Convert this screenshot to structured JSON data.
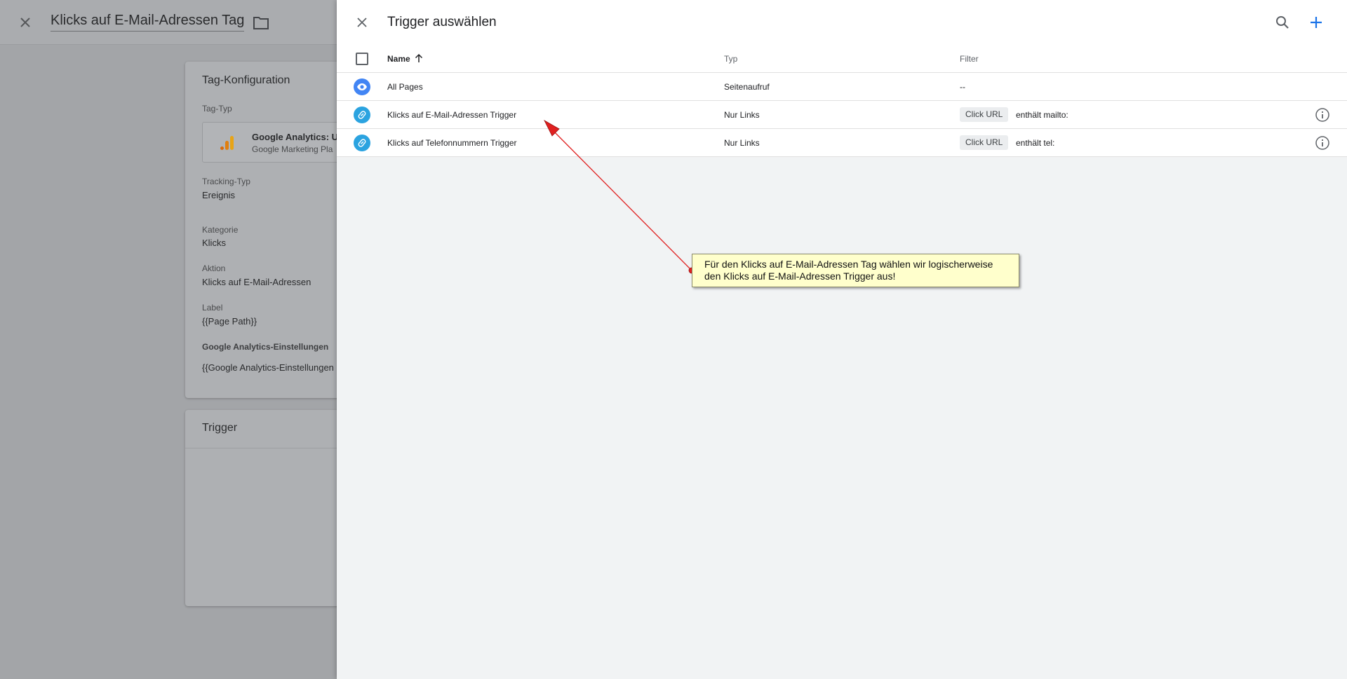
{
  "background_editor": {
    "title": "Klicks auf E-Mail-Adressen Tag",
    "config_card": {
      "title": "Tag-Konfiguration",
      "tag_type_label": "Tag-Typ",
      "tag_type_name": "Google Analytics: Ur",
      "tag_type_sub": "Google Marketing Pla",
      "tracking_type_label": "Tracking-Typ",
      "tracking_type_value": "Ereignis",
      "category_label": "Kategorie",
      "category_value": "Klicks",
      "action_label": "Aktion",
      "action_value": "Klicks auf E-Mail-Adressen",
      "label_label": "Label",
      "label_value": "{{Page Path}}",
      "ga_settings_label": "Google Analytics-Einstellungen",
      "ga_settings_value": "{{Google Analytics-Einstellungen"
    },
    "trigger_card": {
      "title": "Trigger"
    }
  },
  "panel": {
    "title": "Trigger auswählen",
    "columns": {
      "name": "Name",
      "type": "Typ",
      "filter": "Filter"
    },
    "rows": [
      {
        "name": "All Pages",
        "type": "Seitenaufruf",
        "filter_text": "--",
        "icon": "eye-icon"
      },
      {
        "name": "Klicks auf E-Mail-Adressen Trigger",
        "type": "Nur Links",
        "filter_var": "Click URL",
        "filter_op": "enthält mailto:",
        "icon": "link-icon"
      },
      {
        "name": "Klicks auf Telefonnummern Trigger",
        "type": "Nur Links",
        "filter_var": "Click URL",
        "filter_op": "enthält tel:",
        "icon": "link-icon"
      }
    ]
  },
  "annotation": {
    "line1": "Für den Klicks auf E-Mail-Adressen Tag wählen wir logischerweise",
    "line2": "den Klicks auf E-Mail-Adressen Trigger aus!"
  },
  "colors": {
    "accent_blue": "#1a73e8",
    "trigger_icon_blue": "#4285f4",
    "trigger_icon_cyan": "#2ba3e0",
    "annotation_bg": "#ffffcc",
    "arrow_red": "#e02020"
  }
}
